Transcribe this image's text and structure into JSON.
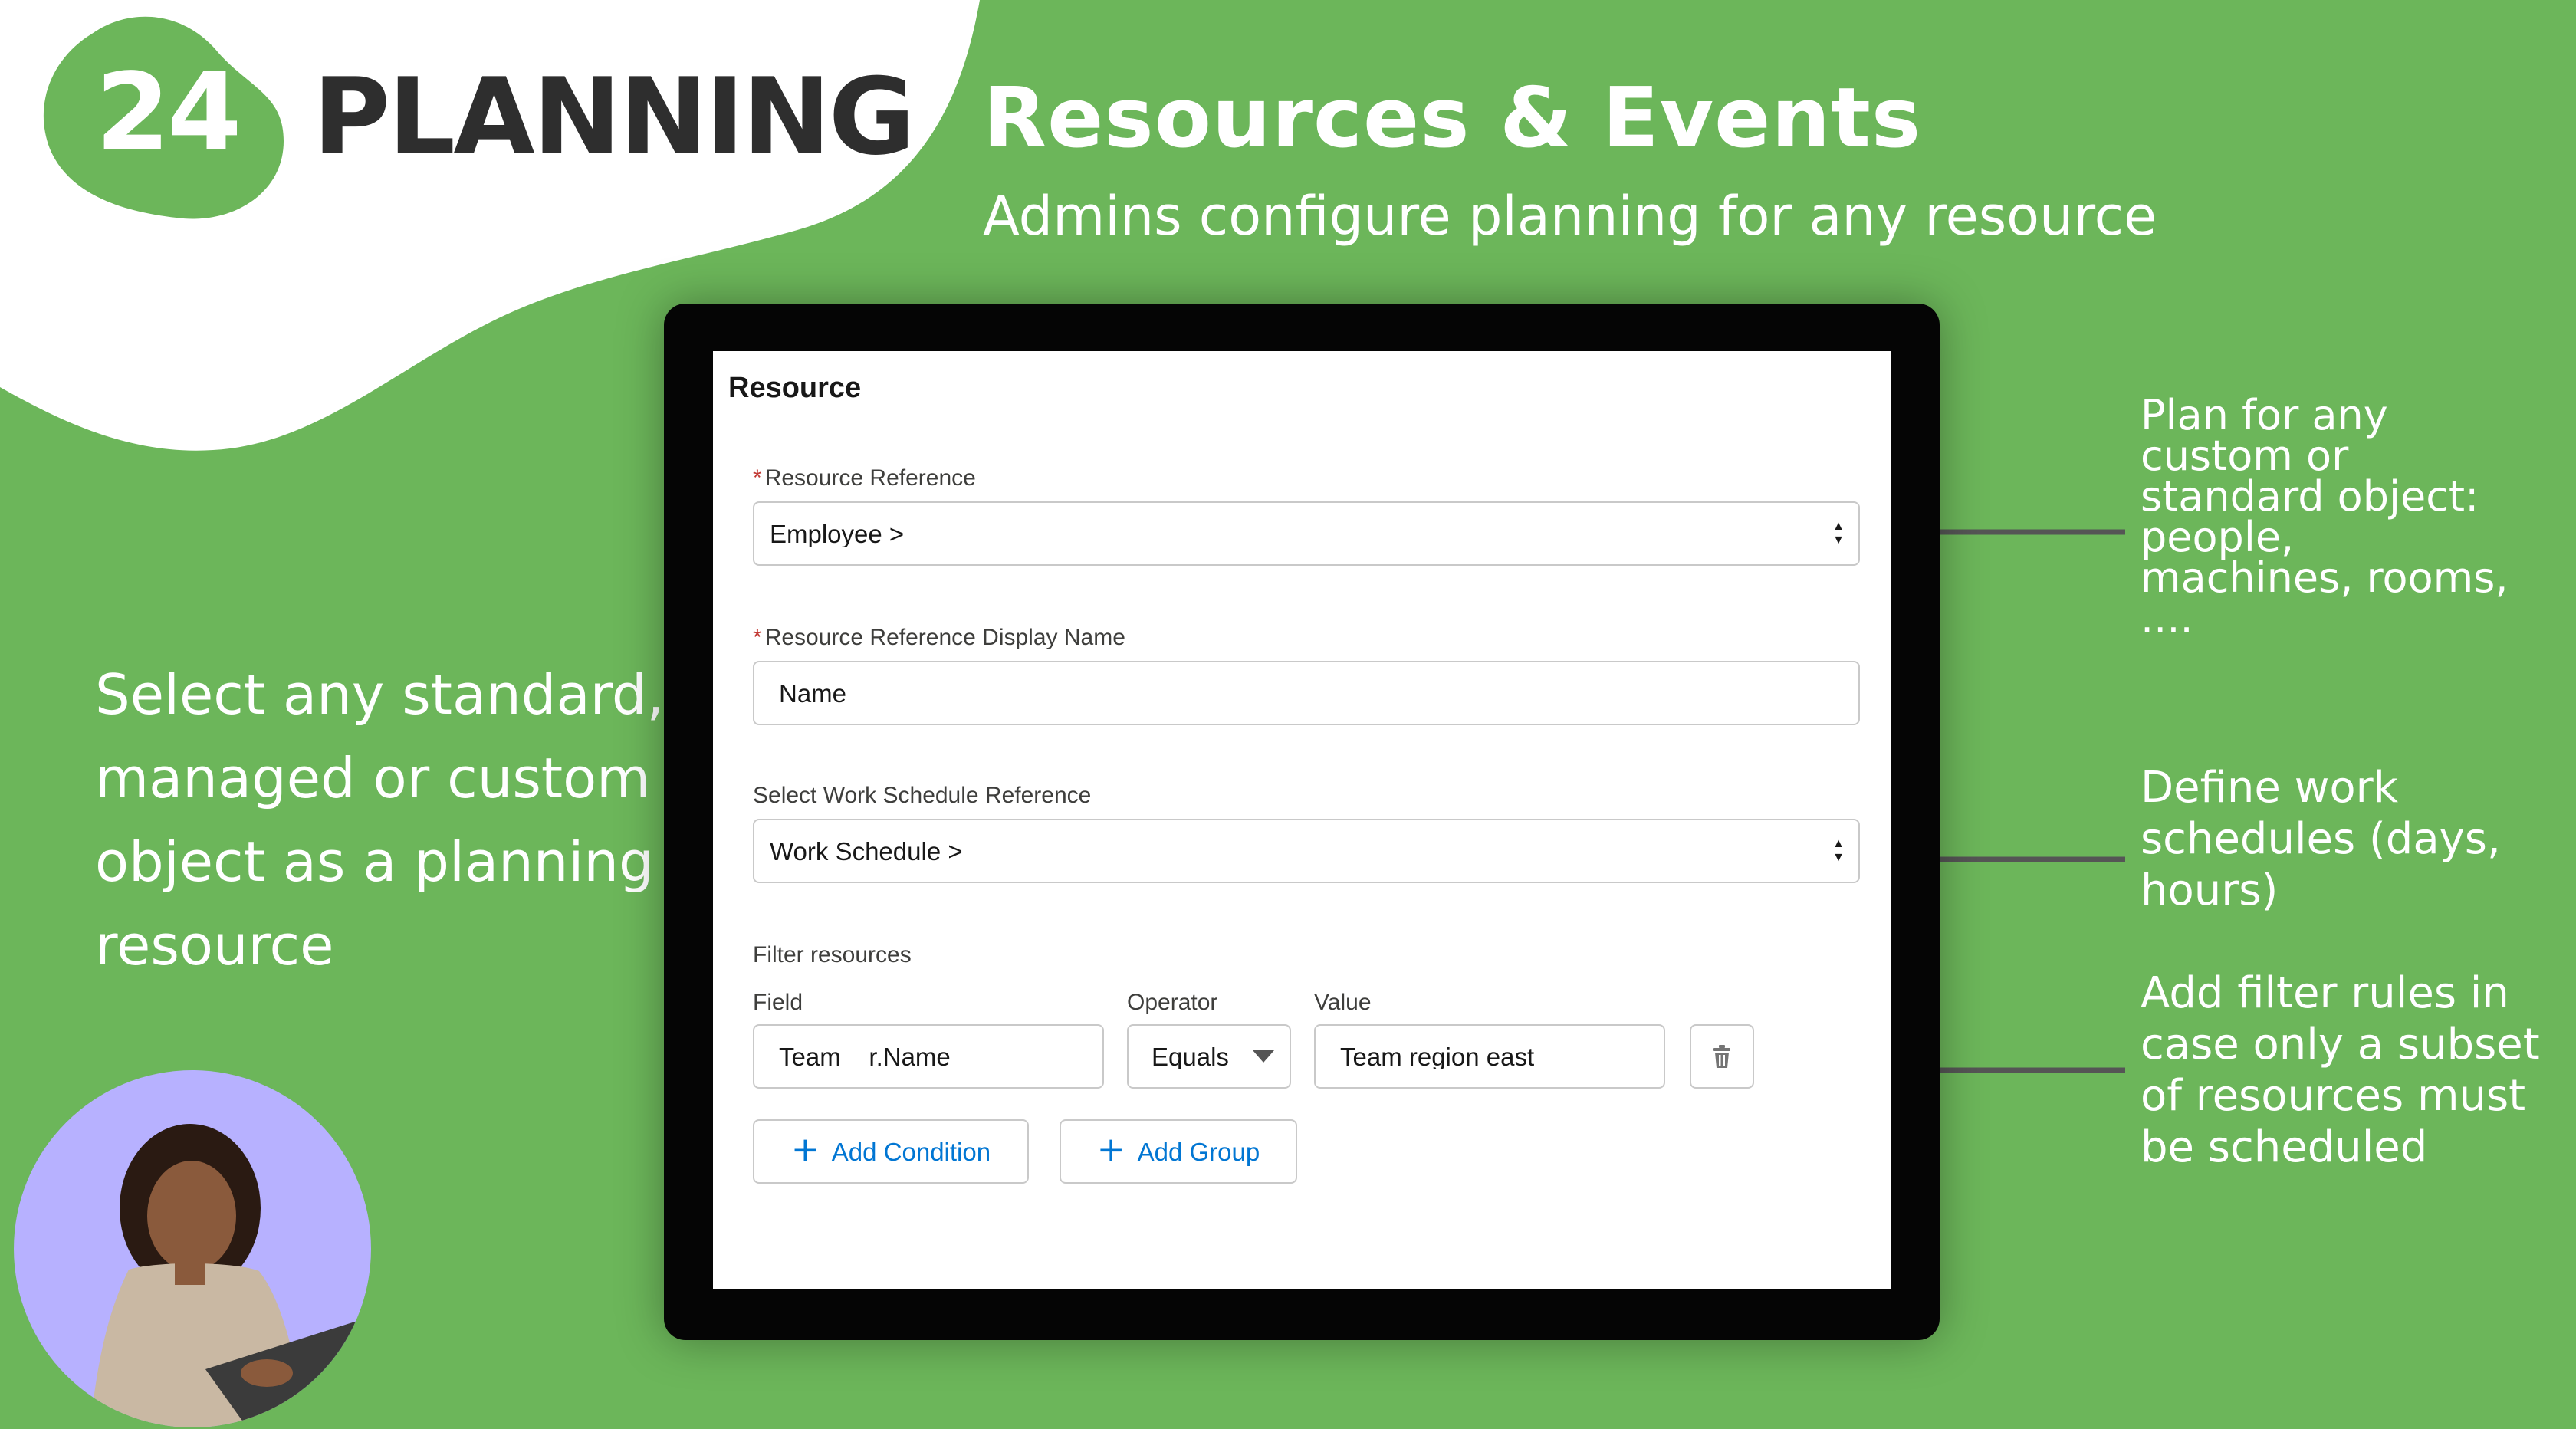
{
  "brand": {
    "number": "24",
    "word": "PLANNING",
    "colors": {
      "background": "#6cb65a",
      "logo_badge": "#6cb65a",
      "logo_text": "#2e2e2e",
      "accent_blue": "#0176d3",
      "avatar_bg": "#b7b1ff"
    }
  },
  "hero": {
    "title": "Resources & Events",
    "subtitle": "Admins configure planning for any resource"
  },
  "left_copy": "Select any standard,\nmanaged or custom\nobject as a planning\nresource",
  "callouts": [
    "Plan for any\ncustom or\nstandard object:\npeople,\nmachines, rooms,\n....",
    "Define work\nschedules (days,\nhours)",
    "Add filter rules in\ncase only a subset\nof resources must\nbe scheduled"
  ],
  "form": {
    "title": "Resource",
    "resource_reference": {
      "label": "Resource Reference",
      "required_mark": "*",
      "value": "Employee >"
    },
    "display_name": {
      "label": "Resource Reference Display Name",
      "required_mark": "*",
      "value": "Name"
    },
    "work_schedule": {
      "label": "Select Work Schedule Reference",
      "value": "Work Schedule >"
    },
    "filter": {
      "section_label": "Filter resources",
      "field_header": "Field",
      "operator_header": "Operator",
      "value_header": "Value",
      "field_value": "Team__r.Name",
      "operator_value": "Equals",
      "value_value": "Team region east",
      "delete_icon": "trash-icon"
    },
    "buttons": {
      "add_condition": "Add Condition",
      "add_group": "Add Group"
    },
    "stepper_up": "▲",
    "stepper_down": "▼"
  }
}
